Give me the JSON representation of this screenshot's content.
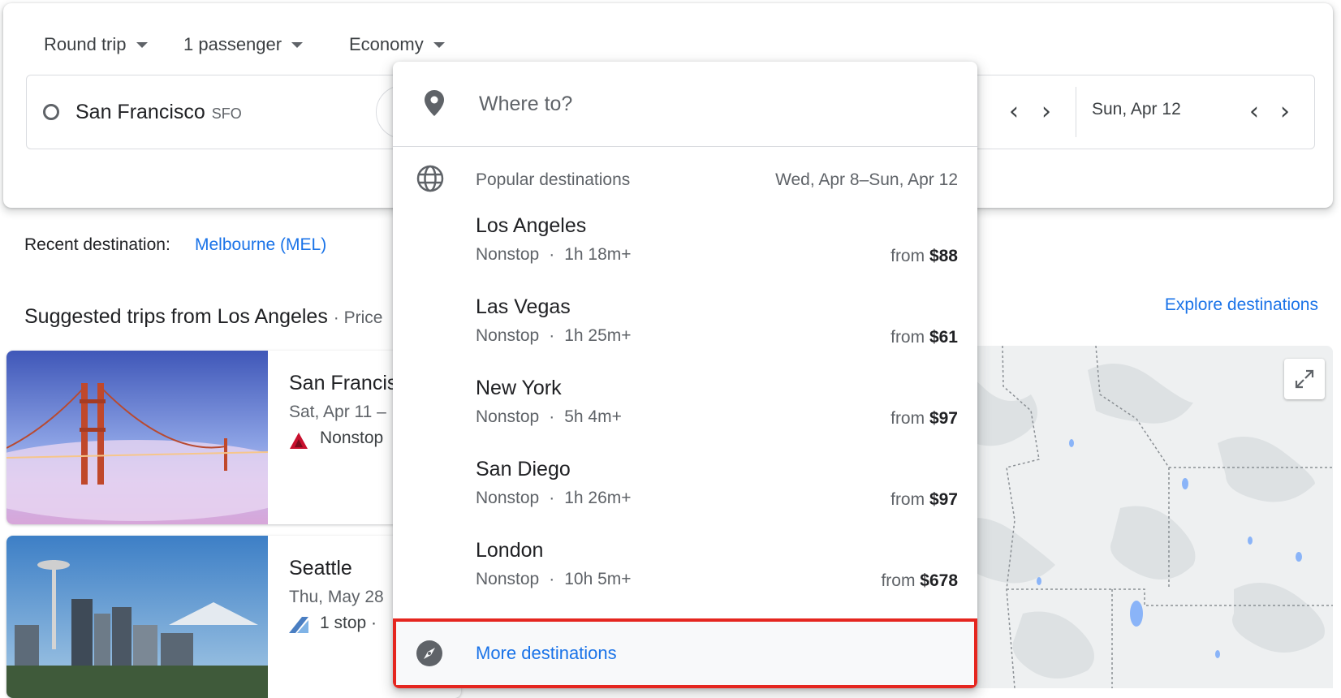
{
  "options": {
    "trip_type": "Round trip",
    "passengers": "1 passenger",
    "cabin_class": "Economy"
  },
  "origin": {
    "city": "San Francisco",
    "code": "SFO"
  },
  "return_date": "Sun, Apr 12",
  "recent": {
    "label": "Recent destination:",
    "link": "Melbourne (MEL)"
  },
  "suggested": {
    "title": "Suggested trips from Los Angeles",
    "subtitle": "· Price",
    "explore_link": "Explore destinations",
    "trips": [
      {
        "city": "San Francis",
        "dates": "Sat, Apr 11 –",
        "stops": "Nonstop",
        "airline_icon": "delta-logo-icon"
      },
      {
        "city": "Seattle",
        "dates": "Thu, May 28",
        "stops": "1 stop  ·",
        "airline_icon": "alaska-logo-icon"
      }
    ]
  },
  "dropdown": {
    "placeholder": "Where to?",
    "header_label": "Popular destinations",
    "header_dates": "Wed, Apr 8–Sun, Apr 12",
    "price_prefix": "from",
    "destinations": [
      {
        "name": "Los Angeles",
        "stops": "Nonstop",
        "duration": "1h 18m+",
        "price": "$88"
      },
      {
        "name": "Las Vegas",
        "stops": "Nonstop",
        "duration": "1h 25m+",
        "price": "$61"
      },
      {
        "name": "New York",
        "stops": "Nonstop",
        "duration": "5h 4m+",
        "price": "$97"
      },
      {
        "name": "San Diego",
        "stops": "Nonstop",
        "duration": "1h 26m+",
        "price": "$97"
      },
      {
        "name": "London",
        "stops": "Nonstop",
        "duration": "10h 5m+",
        "price": "$678"
      }
    ],
    "more_label": "More destinations"
  },
  "colors": {
    "link": "#1a73e8",
    "highlight_border": "#e5261f",
    "muted_text": "#5f6368"
  }
}
